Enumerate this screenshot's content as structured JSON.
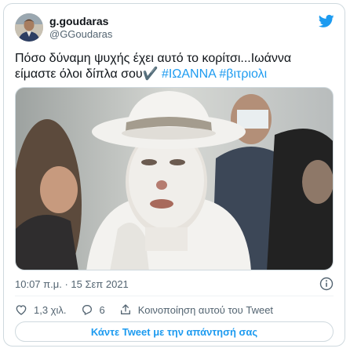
{
  "author": {
    "display_name": "g.goudaras",
    "handle": "@GGoudaras"
  },
  "tweet": {
    "line1": "Πόσο δύναμη ψυχής έχει αυτό το κορίτσι...Ιωάννα",
    "line2_prefix": "είμαστε όλοι δίπλα σου✔️ ",
    "hashtag1": "#ΙΩΑΝΝΑ",
    "hashtag2": "#βιτριολι"
  },
  "timestamp": "10:07 π.μ. · 15 Σεπ 2021",
  "actions": {
    "likes": "1,3 χιλ.",
    "replies": "6",
    "share_label": "Κοινοποίηση αυτού του Tweet"
  },
  "reply_button_label": "Κάντε Tweet με την απάντησή σας",
  "colors": {
    "accent": "#1d9bf0",
    "text": "#0f1419",
    "muted": "#536471",
    "border": "#cfd9de"
  },
  "icons": [
    "twitter-bird-icon",
    "info-icon",
    "heart-icon",
    "reply-icon",
    "share-icon"
  ]
}
